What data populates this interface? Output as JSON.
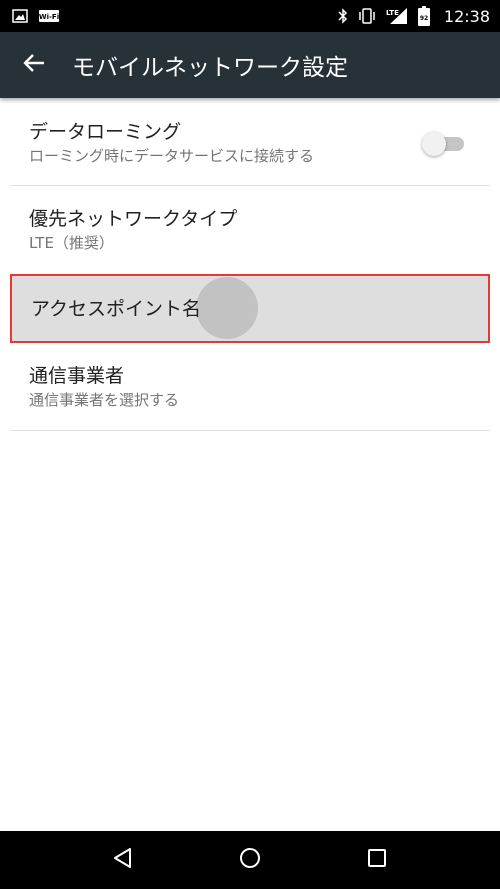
{
  "status_bar": {
    "time": "12:38",
    "battery_level": "92",
    "network_type": "LTE",
    "icons": [
      "image-icon",
      "wifi-calling-icon",
      "bluetooth-icon",
      "vibrate-icon",
      "signal-icon",
      "battery-icon"
    ]
  },
  "app_bar": {
    "title": "モバイルネットワーク設定",
    "back_icon": "arrow-back-icon",
    "background_color": "#263238"
  },
  "settings": {
    "data_roaming": {
      "title": "データローミング",
      "summary": "ローミング時にデータサービスに接続する",
      "enabled": false
    },
    "preferred_network": {
      "title": "優先ネットワークタイプ",
      "summary": "LTE（推奨）"
    },
    "access_point": {
      "title": "アクセスポイント名",
      "highlight_color": "#e53935"
    },
    "network_operator": {
      "title": "通信事業者",
      "summary": "通信事業者を選択する"
    }
  },
  "nav_bar": {
    "buttons": [
      "back-triangle-icon",
      "home-circle-icon",
      "recents-square-icon"
    ]
  }
}
